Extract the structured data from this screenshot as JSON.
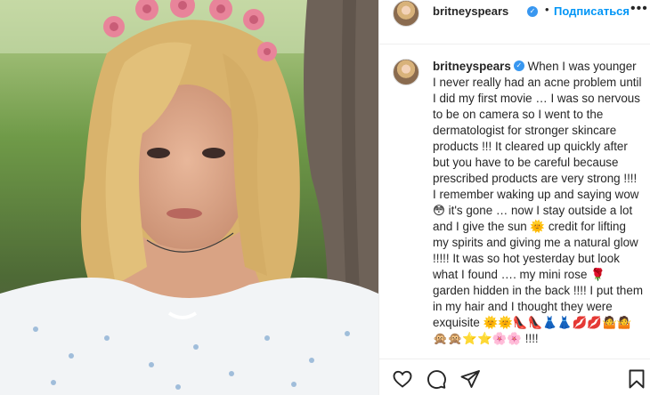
{
  "post": {
    "image_alt": "",
    "author": {
      "username": "britneyspears",
      "verified": true
    },
    "header": {
      "separator": "•",
      "follow_label": "Подписаться",
      "more_label": "•••"
    },
    "caption": {
      "username": "britneyspears",
      "text": "When I was younger I never really had an acne problem until I did my first movie … I was so nervous to be on camera so I went to the dermatologist for stronger skincare products !!! It cleared up quickly after but you have to be careful because prescribed products are very strong !!!! I remember waking up and saying wow 😳 it's gone … now I stay outside a lot and I give the sun 🌞 credit for lifting my spirits and giving me a natural glow !!!!! It was so hot yesterday but look what I found …. my mini rose 🌹 garden hidden in the back !!!! I put them in my hair and I thought they were exquisite 🌞🌞👠👠👗👗💋💋🤷🤷🙊🙊⭐⭐🌸🌸 !!!!"
    },
    "actions": [
      "like-icon",
      "comment-icon",
      "share-icon",
      "save-icon"
    ],
    "colors": {
      "accent": "#0095f6",
      "verified": "#3897f0",
      "border": "#efefef"
    }
  }
}
